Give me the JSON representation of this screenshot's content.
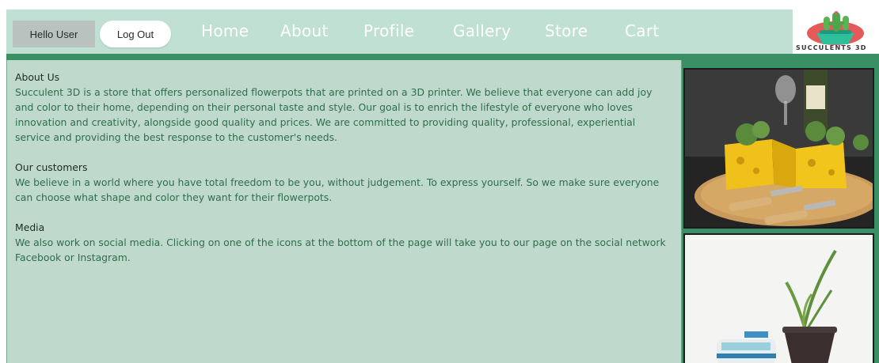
{
  "header": {
    "greeting": "Hello User",
    "logout_label": "Log Out",
    "nav": [
      "Home",
      "About",
      "Profile",
      "Gallery",
      "Store",
      "Cart"
    ],
    "logo_text": "SUCCULENTS 3D"
  },
  "colors": {
    "header_bg": "#bfe0d2",
    "accent": "#3b8f65",
    "content_bg": "#bfd9cc",
    "text_green": "#2f6e4a"
  },
  "content": {
    "sections": [
      {
        "title": "About Us",
        "text": "Succulent 3D is a store that offers personalized flowerpots that are printed on a 3D printer. We believe that everyone can add joy and color to their home, depending on their personal taste and style. Our goal is to enrich the lifestyle of everyone who loves innovation and creativity, alongside good quality and prices. We are committed to providing quality, professional, experiential service and providing the best response to the customer's needs."
      },
      {
        "title": "Our customers",
        "text": "We believe in a world where you have total freedom to be you, without judgement. To express yourself. So we make sure everyone can choose what shape and color they want for their flowerpots."
      },
      {
        "title": "Media",
        "text": "We also work on social media. Clicking on one of the icons at the bottom of the page will take you to our page on the social network Facebook or Instagram."
      }
    ]
  },
  "gallery": {
    "photos": [
      {
        "name": "cheese-flowerpots-photo",
        "icon": "photo-icon"
      },
      {
        "name": "dark-pot-plant-photo",
        "icon": "photo-icon"
      }
    ]
  }
}
